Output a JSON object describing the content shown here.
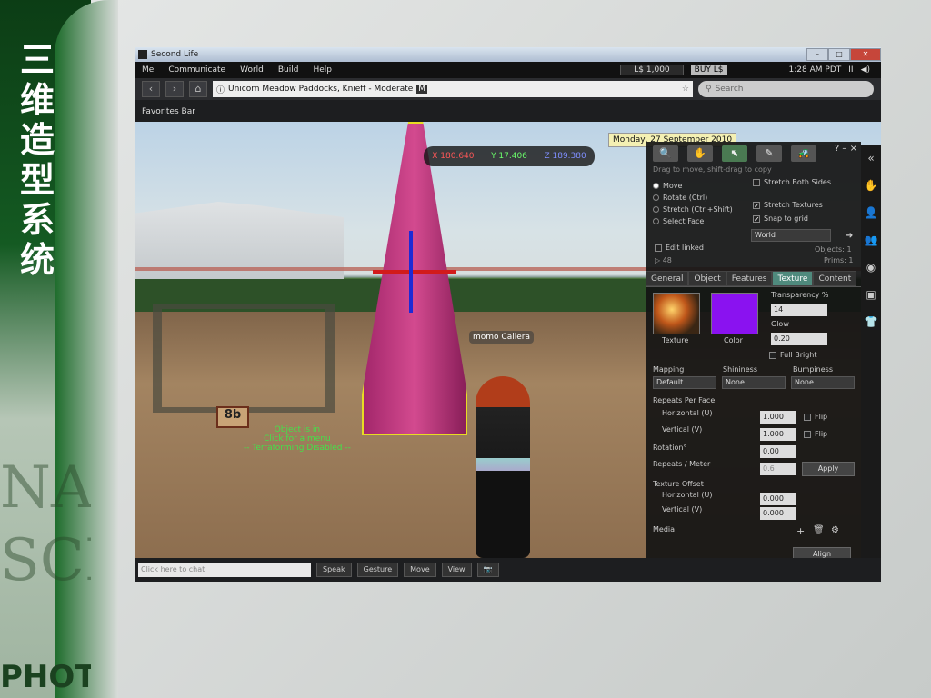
{
  "slide": {
    "title": "三维造型系统",
    "watermark_line1": "NA",
    "watermark_line2": "SCI",
    "watermark_line3": "PHOTO"
  },
  "window": {
    "title": "Second Life",
    "controls": {
      "minimize": "–",
      "maximize": "□",
      "close": "✕"
    }
  },
  "menu": {
    "items": [
      "Me",
      "Communicate",
      "World",
      "Build",
      "Help"
    ],
    "balance": "L$ 1,000",
    "buy": "BUY L$",
    "time": "1:28 AM PDT",
    "pause": "II",
    "volume": "◀)"
  },
  "nav": {
    "back": "‹",
    "forward": "›",
    "home": "⌂",
    "location": "Unicorn Meadow Paddocks, Knieff - Moderate",
    "rating_badge": "M",
    "search_placeholder": "Search"
  },
  "favorites": {
    "label": "Favorites Bar"
  },
  "scene": {
    "coords": {
      "x": "X 180.640",
      "y": "Y 17.406",
      "z": "Z 189.380"
    },
    "date": "Monday, 27 September 2010",
    "avatar_name": "momo Caliera",
    "sign_text": "8b",
    "object_note": [
      "Object is in",
      "Click for a menu",
      "-- Terraforming Disabled --"
    ]
  },
  "build": {
    "help": "?",
    "minimize": "–",
    "close": "×",
    "hint": "Drag to move, shift-drag to copy",
    "tools": [
      "🔍",
      "✋",
      "⬉",
      "✎",
      "🚜"
    ],
    "modes": [
      {
        "label": "Move",
        "selected": true
      },
      {
        "label": "Rotate (Ctrl)",
        "selected": false
      },
      {
        "label": "Stretch (Ctrl+Shift)",
        "selected": false
      },
      {
        "label": "Select Face",
        "selected": false
      }
    ],
    "options": {
      "stretch_both": "Stretch Both Sides",
      "stretch_textures": "Stretch Textures",
      "snap_to_grid": "Snap to grid",
      "grid_mode": "World",
      "edit_linked": "Edit linked"
    },
    "counts": {
      "objects": "Objects: 1",
      "prims": "Prims: 1",
      "land_impact": "▷ 48"
    },
    "tabs": [
      "General",
      "Object",
      "Features",
      "Texture",
      "Content"
    ],
    "active_tab": "Texture",
    "texture": {
      "texture_label": "Texture",
      "color_label": "Color",
      "transparency_label": "Transparency %",
      "transparency": "14",
      "glow_label": "Glow",
      "glow": "0.20",
      "full_bright": "Full Bright",
      "mapping_label": "Mapping",
      "mapping": "Default",
      "shininess_label": "Shininess",
      "shininess": "None",
      "bumpiness_label": "Bumpiness",
      "bumpiness": "None",
      "repeats_per_face": "Repeats Per Face",
      "horizontal_label": "Horizontal (U)",
      "horizontal": "1.000",
      "vertical_label": "Vertical (V)",
      "vertical": "1.000",
      "flip": "Flip",
      "rotation_label": "Rotation°",
      "rotation": "0.00",
      "repeats_meter_label": "Repeats / Meter",
      "repeats_meter": "0.6",
      "apply": "Apply",
      "offset_label": "Texture Offset",
      "offset_h_label": "Horizontal (U)",
      "offset_h": "0.000",
      "offset_v_label": "Vertical (V)",
      "offset_v": "0.000",
      "media_label": "Media",
      "align": "Align",
      "color_hex": "#8a12f0"
    }
  },
  "sidebar": {
    "icons": [
      "«",
      "✋",
      "👤",
      "👥",
      "◉",
      "▣",
      "👕"
    ]
  },
  "bottom": {
    "chat_placeholder": "Click here to chat",
    "speak": "Speak",
    "gesture": "Gesture",
    "move": "Move",
    "view": "View",
    "snapshot": "📷"
  }
}
